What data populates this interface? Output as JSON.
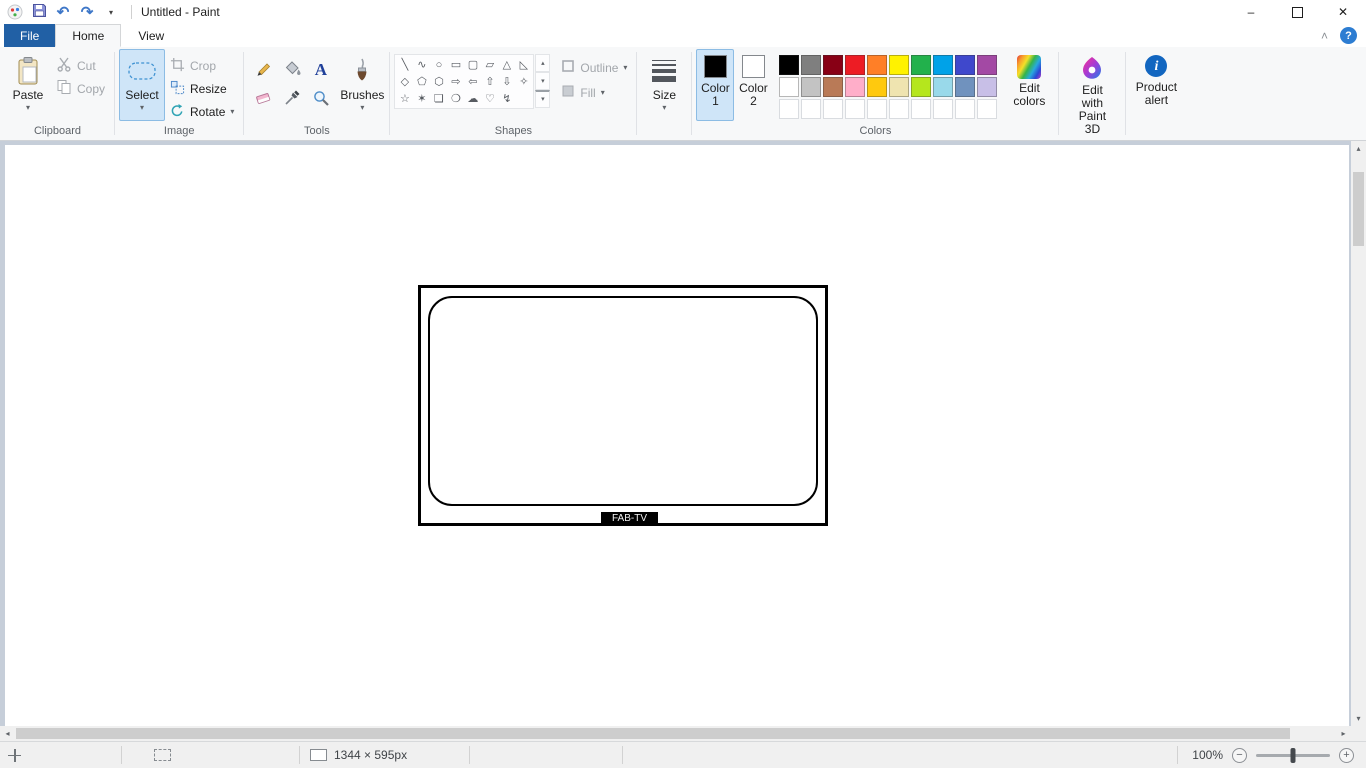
{
  "window": {
    "title": "Untitled - Paint",
    "controls": {
      "minimize": "–",
      "close": "✕"
    }
  },
  "icons": {
    "undo": "↶",
    "redo": "↷",
    "qat_dropdown": "▾",
    "ribbon_collapse": "˄",
    "help": "?",
    "product_alert_glyph": "i",
    "dropdown_arrow": "▾",
    "scroll_up": "▴",
    "scroll_down": "▾",
    "scroll_left": "◂",
    "scroll_right": "▸"
  },
  "tabs": {
    "file": "File",
    "home": "Home",
    "view": "View"
  },
  "ribbon": {
    "clipboard": {
      "group_label": "Clipboard",
      "paste_label": "Paste",
      "cut_label": "Cut",
      "copy_label": "Copy"
    },
    "image": {
      "group_label": "Image",
      "select_label": "Select",
      "crop_label": "Crop",
      "resize_label": "Resize",
      "rotate_label": "Rotate"
    },
    "tools": {
      "group_label": "Tools",
      "brushes_label": "Brushes",
      "text_tool_glyph": "A"
    },
    "shapes": {
      "group_label": "Shapes",
      "outline_label": "Outline",
      "fill_label": "Fill",
      "glyphs": [
        {
          "name": "line",
          "glyph": "╲"
        },
        {
          "name": "curve",
          "glyph": "∿"
        },
        {
          "name": "oval",
          "glyph": "○"
        },
        {
          "name": "rectangle",
          "glyph": "▭"
        },
        {
          "name": "rounded-rectangle",
          "glyph": "▢"
        },
        {
          "name": "polygon",
          "glyph": "▱"
        },
        {
          "name": "triangle",
          "glyph": "△"
        },
        {
          "name": "right-triangle",
          "glyph": "◺"
        },
        {
          "name": "diamond",
          "glyph": "◇"
        },
        {
          "name": "pentagon",
          "glyph": "⬠"
        },
        {
          "name": "hexagon",
          "glyph": "⬡"
        },
        {
          "name": "right-arrow",
          "glyph": "⇨"
        },
        {
          "name": "left-arrow",
          "glyph": "⇦"
        },
        {
          "name": "up-arrow",
          "glyph": "⇧"
        },
        {
          "name": "down-arrow",
          "glyph": "⇩"
        },
        {
          "name": "four-point-star",
          "glyph": "✧"
        },
        {
          "name": "five-point-star",
          "glyph": "☆"
        },
        {
          "name": "six-point-star",
          "glyph": "✶"
        },
        {
          "name": "rounded-callout",
          "glyph": "❏"
        },
        {
          "name": "oval-callout",
          "glyph": "❍"
        },
        {
          "name": "cloud-callout",
          "glyph": "☁"
        },
        {
          "name": "heart",
          "glyph": "♡"
        },
        {
          "name": "lightning",
          "glyph": "↯"
        }
      ]
    },
    "size": {
      "label": "Size"
    },
    "colors": {
      "group_label": "Colors",
      "color1_label": "Color 1",
      "color2_label": "Color 2",
      "color1_value": "#000000",
      "color2_value": "#ffffff",
      "edit_colors_label": "Edit colors",
      "palette": [
        "#000000",
        "#7f7f7f",
        "#880015",
        "#ed1c24",
        "#ff7f27",
        "#fff200",
        "#22b14c",
        "#00a2e8",
        "#3f48cc",
        "#a349a4",
        "#ffffff",
        "#c3c3c3",
        "#b97a57",
        "#ffaec9",
        "#ffc90e",
        "#efe4b0",
        "#b5e61d",
        "#99d9ea",
        "#7092be",
        "#c8bfe7",
        null,
        null,
        null,
        null,
        null,
        null,
        null,
        null,
        null,
        null
      ]
    },
    "paint3d_label": "Edit with Paint 3D",
    "product_alert_label": "Product alert"
  },
  "canvas": {
    "drawing_text": "FAB-TV"
  },
  "status_bar": {
    "canvas_dimensions": "1344 × 595px",
    "zoom_level": "100%",
    "zoom_out": "−",
    "zoom_in": "+"
  }
}
